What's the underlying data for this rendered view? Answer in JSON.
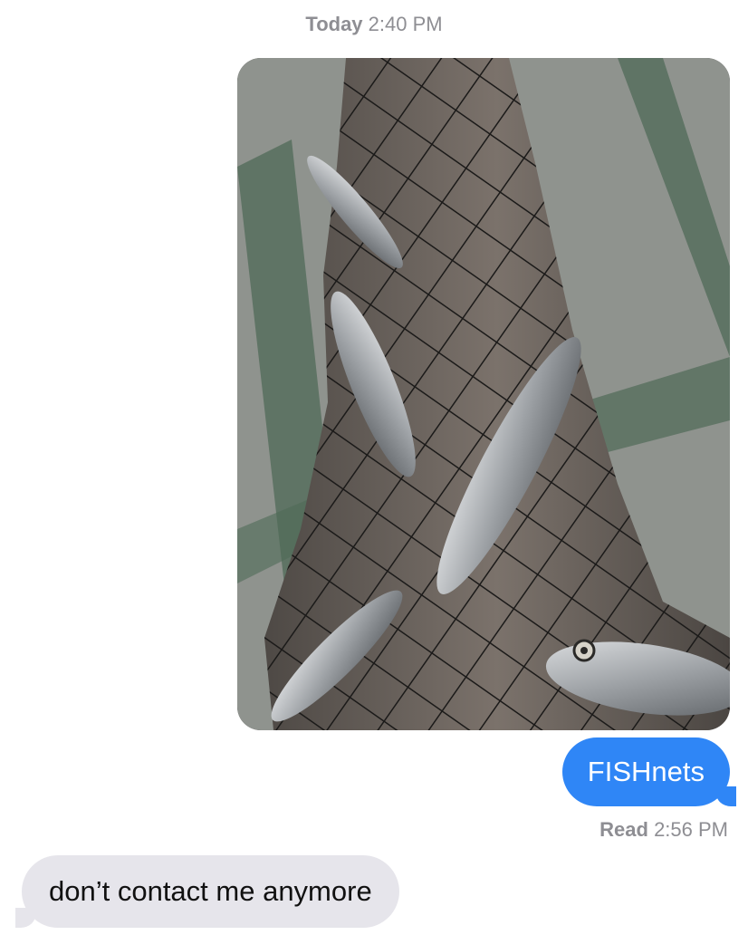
{
  "thread": {
    "timestamp_day": "Today",
    "timestamp_time": "2:40 PM"
  },
  "photo": {
    "icon": "image-attachment",
    "colors": {
      "floor": "#8f938e",
      "tile_stripe": "#4f6a57",
      "skin": "#6e6660",
      "net": "#1b1a19",
      "fish": "#b9bcc0"
    }
  },
  "outgoing_message": {
    "text": "FISHnets",
    "color": "#2f86f6"
  },
  "read_receipt": {
    "label": "Read",
    "time": "2:56 PM"
  },
  "incoming_message": {
    "text": "don’t contact me anymore",
    "color": "#e6e5eb"
  }
}
